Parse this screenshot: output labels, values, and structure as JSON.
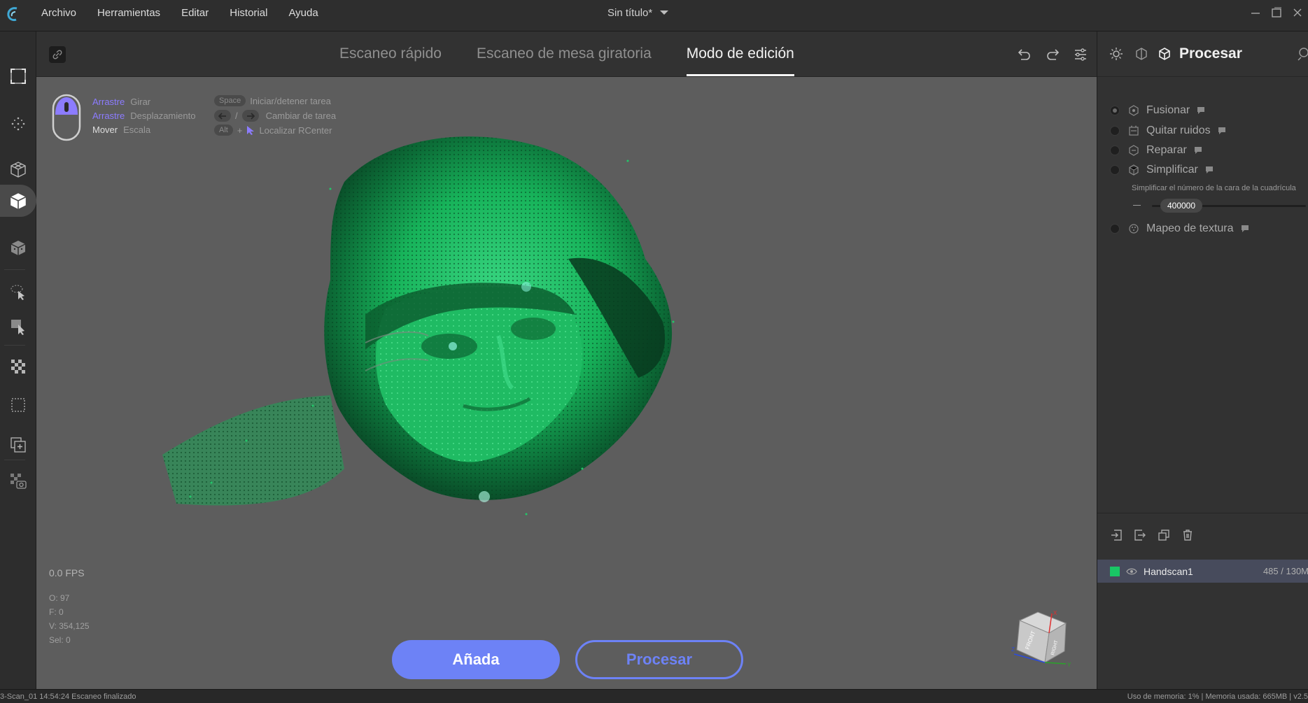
{
  "app": {
    "menu": [
      "Archivo",
      "Herramientas",
      "Editar",
      "Historial",
      "Ayuda"
    ],
    "document_title": "Sin título*"
  },
  "mode_tabs": [
    {
      "label": "Escaneo rápido",
      "active": false
    },
    {
      "label": "Escaneo de mesa giratoria",
      "active": false
    },
    {
      "label": "Modo de edición",
      "active": true
    }
  ],
  "hints": {
    "rows": [
      {
        "key": "Arrastre",
        "action": "Girar"
      },
      {
        "key": "Arrastre",
        "action": "Desplazamiento"
      },
      {
        "key": "Mover",
        "action": "Escala"
      }
    ],
    "shortcuts": [
      {
        "key": "Space",
        "action": "Iniciar/detener tarea"
      },
      {
        "key": "",
        "action": "Cambiar de tarea"
      },
      {
        "key": "Alt",
        "action": "Localizar RCenter"
      }
    ],
    "arrow_separator": "/",
    "alt_separator": "+"
  },
  "viewport": {
    "fps": "0.0 FPS",
    "stats": [
      "O: 97",
      "F: 0",
      "V: 354,125",
      "Sel: 0"
    ],
    "add_button": "Añada",
    "process_button": "Procesar",
    "view_cube": {
      "front": "FRONT",
      "right": "RIGHT",
      "axes": [
        "X",
        "Y",
        "Z"
      ]
    },
    "point_color": "#19c765"
  },
  "right_panel": {
    "title": "Procesar",
    "steps": [
      {
        "label": "Fusionar",
        "selected": true
      },
      {
        "label": "Quitar ruidos",
        "selected": false
      },
      {
        "label": "Reparar",
        "selected": false
      },
      {
        "label": "Simplificar",
        "selected": false
      },
      {
        "label": "Mapeo de textura",
        "selected": false
      }
    ],
    "simplify": {
      "description": "Simplificar el número de la cara de la cuadrícula",
      "value": "400000"
    },
    "layers": [
      {
        "name": "Handscan1",
        "color": "#19c765",
        "count": "485 / 130M"
      }
    ]
  },
  "status": {
    "left": "3-Scan_01    14:54:24 Escaneo finalizado",
    "right": "Uso de memoria: 1% | Memoria usada: 665MB | v2.5"
  },
  "colors": {
    "accent": "#6d82f6",
    "hint_key": "#8c7cff",
    "background": "#5d5d5d"
  }
}
